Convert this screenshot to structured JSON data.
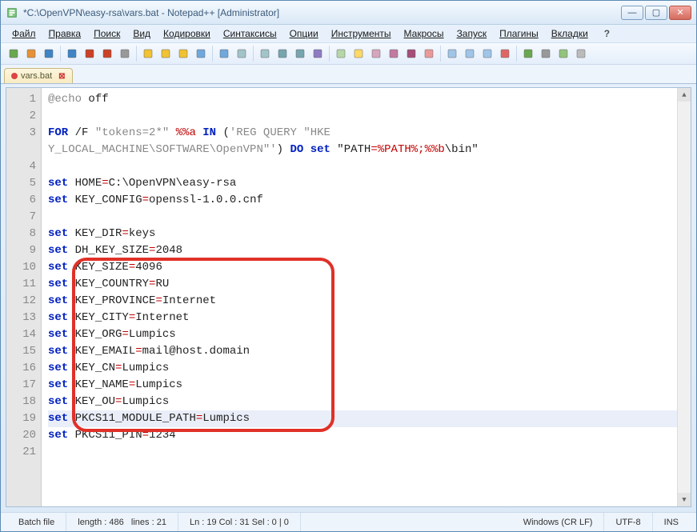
{
  "window": {
    "title": "*C:\\OpenVPN\\easy-rsa\\vars.bat - Notepad++ [Administrator]"
  },
  "menu": {
    "items": [
      "Файл",
      "Правка",
      "Поиск",
      "Вид",
      "Кодировки",
      "Синтаксисы",
      "Опции",
      "Инструменты",
      "Макросы",
      "Запуск",
      "Плагины",
      "Вкладки"
    ],
    "help": "?"
  },
  "toolbar_icons": [
    "new",
    "open",
    "save",
    "save-all",
    "close",
    "close-all",
    "print",
    "cut",
    "copy",
    "paste",
    "undo",
    "redo",
    "find",
    "replace",
    "zoom-in",
    "zoom-out",
    "sync",
    "wrap",
    "ws",
    "indent",
    "lang",
    "folder",
    "fn",
    "doc1",
    "doc2",
    "compare",
    "rec",
    "play",
    "stop",
    "macro",
    "menu"
  ],
  "tab": {
    "label": "vars.bat"
  },
  "code": {
    "lines": [
      [
        {
          "t": "@echo",
          "c": "gray"
        },
        {
          "t": " off",
          "c": "plain"
        }
      ],
      [],
      [
        {
          "t": "FOR",
          "c": "kw"
        },
        {
          "t": " /F ",
          "c": "plain"
        },
        {
          "t": "\"tokens=2*\"",
          "c": "gray"
        },
        {
          "t": " ",
          "c": "plain"
        },
        {
          "t": "%%a",
          "c": "op"
        },
        {
          "t": " ",
          "c": "plain"
        },
        {
          "t": "IN",
          "c": "kw"
        },
        {
          "t": " (",
          "c": "plain"
        },
        {
          "t": "'REG QUERY \"HKEY_LOCAL_MACHINE\\SOFTWARE\\OpenVPN\"'",
          "c": "gray"
        },
        {
          "t": ") ",
          "c": "plain"
        },
        {
          "t": "DO",
          "c": "kw"
        },
        {
          "t": " ",
          "c": "plain"
        },
        {
          "t": "set",
          "c": "kw"
        },
        {
          "t": " \"PATH",
          "c": "plain"
        },
        {
          "t": "=",
          "c": "op"
        },
        {
          "t": "%PATH%",
          "c": "op"
        },
        {
          "t": ";",
          "c": "op"
        },
        {
          "t": "%%b",
          "c": "op"
        },
        {
          "t": "\\bin\"",
          "c": "plain"
        }
      ],
      [],
      [
        {
          "t": "set",
          "c": "kw"
        },
        {
          "t": " HOME",
          "c": "plain"
        },
        {
          "t": "=",
          "c": "op"
        },
        {
          "t": "C:\\OpenVPN\\easy-rsa",
          "c": "plain"
        }
      ],
      [
        {
          "t": "set",
          "c": "kw"
        },
        {
          "t": " KEY_CONFIG",
          "c": "plain"
        },
        {
          "t": "=",
          "c": "op"
        },
        {
          "t": "openssl-1.0.0.cnf",
          "c": "plain"
        }
      ],
      [],
      [
        {
          "t": "set",
          "c": "kw"
        },
        {
          "t": " KEY_DIR",
          "c": "plain"
        },
        {
          "t": "=",
          "c": "op"
        },
        {
          "t": "keys",
          "c": "plain"
        }
      ],
      [
        {
          "t": "set",
          "c": "kw"
        },
        {
          "t": " DH_KEY_SIZE",
          "c": "plain"
        },
        {
          "t": "=",
          "c": "op"
        },
        {
          "t": "2048",
          "c": "plain"
        }
      ],
      [
        {
          "t": "set",
          "c": "kw"
        },
        {
          "t": " KEY_SIZE",
          "c": "plain"
        },
        {
          "t": "=",
          "c": "op"
        },
        {
          "t": "4096",
          "c": "plain"
        }
      ],
      [
        {
          "t": "set",
          "c": "kw"
        },
        {
          "t": " KEY_COUNTRY",
          "c": "plain"
        },
        {
          "t": "=",
          "c": "op"
        },
        {
          "t": "RU",
          "c": "plain"
        }
      ],
      [
        {
          "t": "set",
          "c": "kw"
        },
        {
          "t": " KEY_PROVINCE",
          "c": "plain"
        },
        {
          "t": "=",
          "c": "op"
        },
        {
          "t": "Internet",
          "c": "plain"
        }
      ],
      [
        {
          "t": "set",
          "c": "kw"
        },
        {
          "t": " KEY_CITY",
          "c": "plain"
        },
        {
          "t": "=",
          "c": "op"
        },
        {
          "t": "Internet",
          "c": "plain"
        }
      ],
      [
        {
          "t": "set",
          "c": "kw"
        },
        {
          "t": " KEY_ORG",
          "c": "plain"
        },
        {
          "t": "=",
          "c": "op"
        },
        {
          "t": "Lumpics",
          "c": "plain"
        }
      ],
      [
        {
          "t": "set",
          "c": "kw"
        },
        {
          "t": " KEY_EMAIL",
          "c": "plain"
        },
        {
          "t": "=",
          "c": "op"
        },
        {
          "t": "mail@host.domain",
          "c": "plain"
        }
      ],
      [
        {
          "t": "set",
          "c": "kw"
        },
        {
          "t": " KEY_CN",
          "c": "plain"
        },
        {
          "t": "=",
          "c": "op"
        },
        {
          "t": "Lumpics",
          "c": "plain"
        }
      ],
      [
        {
          "t": "set",
          "c": "kw"
        },
        {
          "t": " KEY_NAME",
          "c": "plain"
        },
        {
          "t": "=",
          "c": "op"
        },
        {
          "t": "Lumpics",
          "c": "plain"
        }
      ],
      [
        {
          "t": "set",
          "c": "kw"
        },
        {
          "t": " KEY_OU",
          "c": "plain"
        },
        {
          "t": "=",
          "c": "op"
        },
        {
          "t": "Lumpics",
          "c": "plain"
        }
      ],
      [
        {
          "t": "set",
          "c": "kw"
        },
        {
          "t": " PKCS11_MODULE_PATH",
          "c": "plain"
        },
        {
          "t": "=",
          "c": "op"
        },
        {
          "t": "Lumpics",
          "c": "plain"
        }
      ],
      [
        {
          "t": "set",
          "c": "kw"
        },
        {
          "t": " PKCS11_PIN",
          "c": "plain"
        },
        {
          "t": "=",
          "c": "op"
        },
        {
          "t": "1234",
          "c": "plain"
        }
      ],
      []
    ],
    "wrap_line_3_at": 42,
    "current_line_index": 18
  },
  "status": {
    "lang": "Batch file",
    "length": "length : 486",
    "lines": "lines : 21",
    "pos": "Ln : 19   Col : 31   Sel : 0 | 0",
    "eol": "Windows (CR LF)",
    "enc": "UTF-8",
    "ins": "INS"
  }
}
